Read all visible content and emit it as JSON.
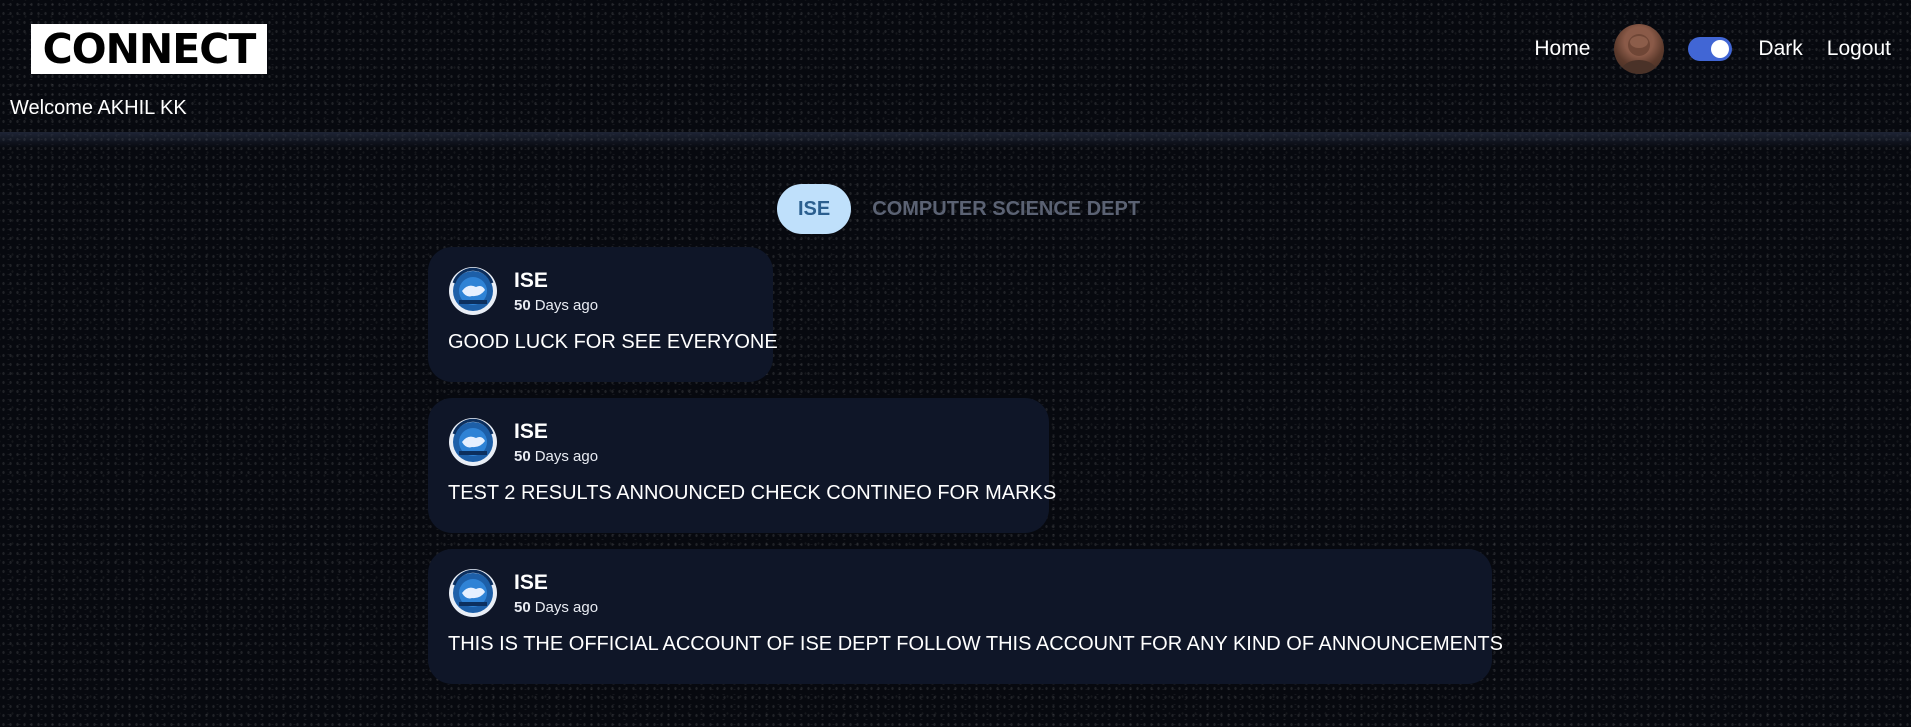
{
  "header": {
    "logo_text": "CONNECT",
    "welcome": "Welcome AKHIL KK",
    "nav": {
      "home": "Home",
      "theme_label": "Dark",
      "logout": "Logout"
    },
    "theme_toggle_on": true
  },
  "tabs": [
    {
      "label": "ISE",
      "active": true
    },
    {
      "label": "COMPUTER SCIENCE DEPT",
      "active": false
    }
  ],
  "posts": [
    {
      "author": "ISE",
      "age_number": "50",
      "age_unit": "Days ago",
      "body": "GOOD LUCK FOR SEE EVERYONE"
    },
    {
      "author": "ISE",
      "age_number": "50",
      "age_unit": "Days ago",
      "body": "TEST 2 RESULTS ANNOUNCED CHECK CONTINEO FOR MARKS"
    },
    {
      "author": "ISE",
      "age_number": "50",
      "age_unit": "Days ago",
      "body": "THIS IS THE OFFICIAL ACCOUNT OF ISE DEPT FOLLOW THIS ACCOUNT FOR ANY KIND OF ANNOUNCEMENTS"
    }
  ],
  "colors": {
    "background": "#07090f",
    "card": "#0f1628",
    "tab_active_bg": "#bfe0fb",
    "tab_active_text": "#2b5f8f",
    "tab_inactive_text": "#5b6273",
    "toggle": "#4166d5"
  },
  "icons": {
    "user_avatar": "profile-photo",
    "post_avatar": "department-emblem"
  }
}
